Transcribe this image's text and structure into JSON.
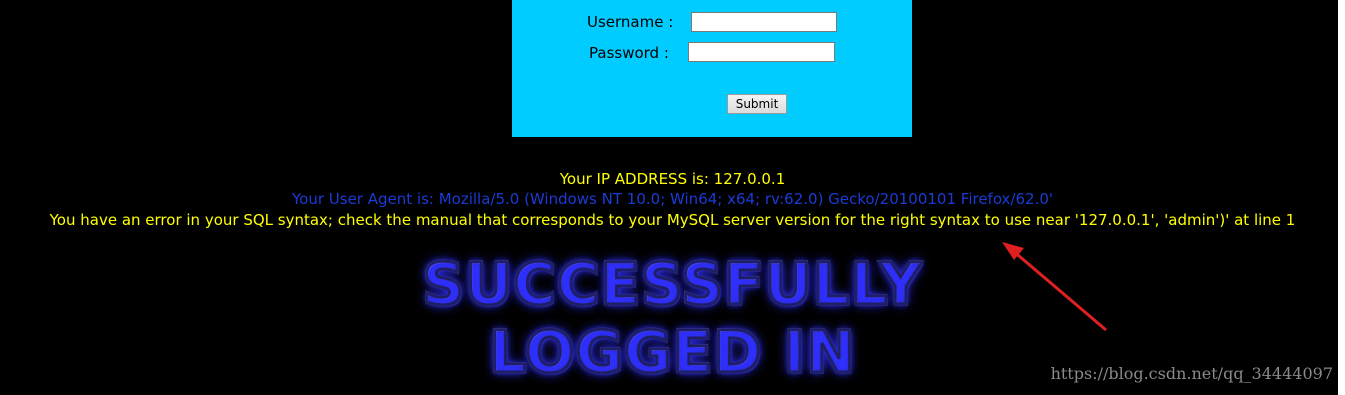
{
  "login_form": {
    "username_label": "Username :",
    "username_value": "",
    "password_label": "Password :",
    "password_value": "",
    "submit_label": "Submit"
  },
  "info": {
    "ip_text": "Your IP ADDRESS is: 127.0.0.1",
    "user_agent_text": "Your User Agent is: Mozilla/5.0 (Windows NT 10.0; Win64; x64; rv:62.0) Gecko/20100101 Firefox/62.0'",
    "sql_error_text": "You have an error in your SQL syntax; check the manual that corresponds to your MySQL server version for the right syntax to use near '127.0.0.1', 'admin')' at line 1"
  },
  "banner": {
    "line1": "SUCCESSFULLY",
    "line2": "LOGGED IN"
  },
  "watermark": "https://blog.csdn.net/qq_34444097",
  "colors": {
    "panel_bg": "#00ccff",
    "page_bg": "#000000",
    "ip_text": "#ffff00",
    "user_agent_text": "#1a3bd6",
    "error_text": "#ffff00",
    "annotation_arrow": "#e02020"
  },
  "annotation": {
    "icon": "red-arrow-icon"
  }
}
